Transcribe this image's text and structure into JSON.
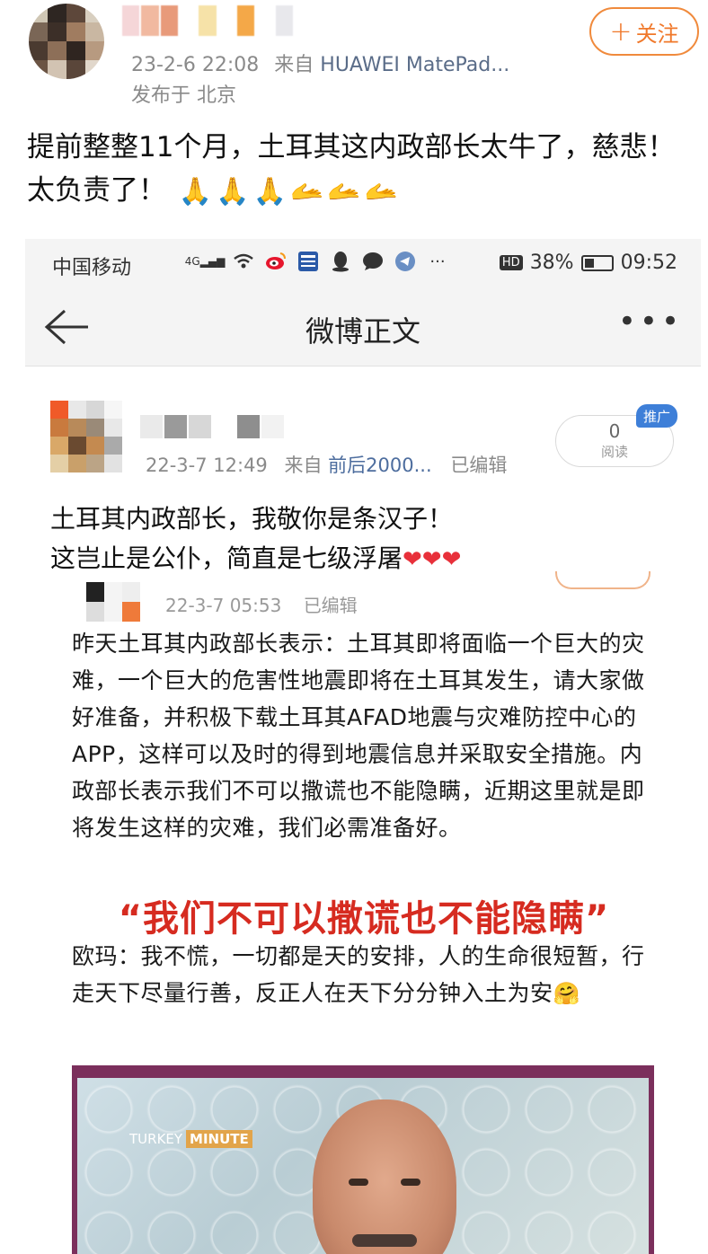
{
  "outer_post": {
    "timestamp": "23-2-6 22:08",
    "source_prefix": "来自",
    "source": "HUAWEI MatePad...",
    "location": "发布于 北京",
    "follow_label": "关注",
    "text": "提前整整11个月，土耳其这内政部长太牛了，慈悲！太负责了！",
    "emojis": [
      "🙏",
      "🙏",
      "🙏",
      "🫴",
      "🫴",
      "🫴"
    ]
  },
  "status_bar": {
    "carrier": "中国移动",
    "signal": "4G",
    "battery": "38%",
    "time": "09:52",
    "hd": "HD"
  },
  "nav_bar": {
    "title": "微博正文",
    "more": "•••"
  },
  "inner_post": {
    "timestamp": "22-3-7 12:49",
    "source_prefix": "来自",
    "source": "前后2000...",
    "edited": "已编辑",
    "read_count": "0",
    "read_label": "阅读",
    "promo_badge": "推广",
    "text_line1": "土耳其内政部长，我敬你是条汉子！",
    "text_line2": "这岂止是公仆，简直是七级浮屠"
  },
  "nested_post": {
    "timestamp": "22-3-7 05:53",
    "edited": "已编辑",
    "body": "昨天土耳其内政部长表示：土耳其即将面临一个巨大的灾难，一个巨大的危害性地震即将在土耳其发生，请大家做好准备，并积极下载土耳其AFAD地震与灾难防控中心的APP，这样可以及时的得到地震信息并采取安全措施。内政部长表示我们不可以撒谎也不能隐瞒，近期这里就是即将发生这样的灾难，我们必需准备好。",
    "quote": "“我们不可以撒谎也不能隐瞒”",
    "body2": "欧玛：我不慌，一切都是天的安排，人的生命很短暂，行走天下尽量行善，反正人在天下分分钟入土为安",
    "video_logo_a": "TURKEY",
    "video_logo_b": "MINUTE"
  },
  "colors": {
    "accent_orange": "#f0782a",
    "link_blue": "#4d6d9e",
    "quote_red": "#d62b20",
    "promo_blue": "#3e7fd8"
  }
}
